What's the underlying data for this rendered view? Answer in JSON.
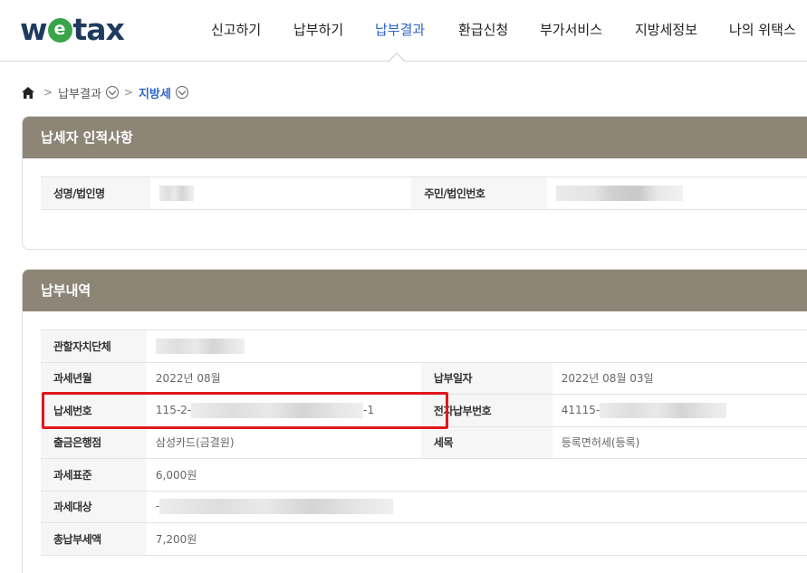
{
  "logo": {
    "prefix": "w",
    "mark": "e",
    "suffix": "tax"
  },
  "nav": [
    {
      "label": "신고하기"
    },
    {
      "label": "납부하기"
    },
    {
      "label": "납부결과"
    },
    {
      "label": "환급신청"
    },
    {
      "label": "부가서비스"
    },
    {
      "label": "지방세정보"
    },
    {
      "label": "나의 위택스"
    }
  ],
  "breadcrumb": {
    "level1": "납부결과",
    "level2": "지방세"
  },
  "taxpayer": {
    "title": "납세자 인적사항",
    "name_label": "성명/법인명",
    "id_label": "주민/법인번호"
  },
  "payment": {
    "title": "납부내역",
    "rows": {
      "municipality_label": "관할자치단체",
      "tax_month_label": "과세년월",
      "tax_month_value": "2022년 08월",
      "pay_date_label": "납부일자",
      "pay_date_value": "2022년 08월 03일",
      "tax_number_label": "납세번호",
      "tax_number_prefix": "115-2-",
      "tax_number_suffix": "-1",
      "epay_label": "전자납부번호",
      "epay_prefix": "41115-",
      "bank_label": "출금은행점",
      "bank_value": "삼성카드(금결원)",
      "item_label": "세목",
      "item_value": "등록면허세(등록)",
      "base_label": "과세표준",
      "base_value": "6,000원",
      "object_label": "과세대상",
      "object_prefix": "-",
      "total_label": "총납부세액",
      "total_value": "7,200원"
    }
  },
  "colors": {
    "panel_header": "#8d8576",
    "active_nav": "#2d63c8",
    "highlight": "#e0171b",
    "logo_mark": "#3aa449"
  }
}
